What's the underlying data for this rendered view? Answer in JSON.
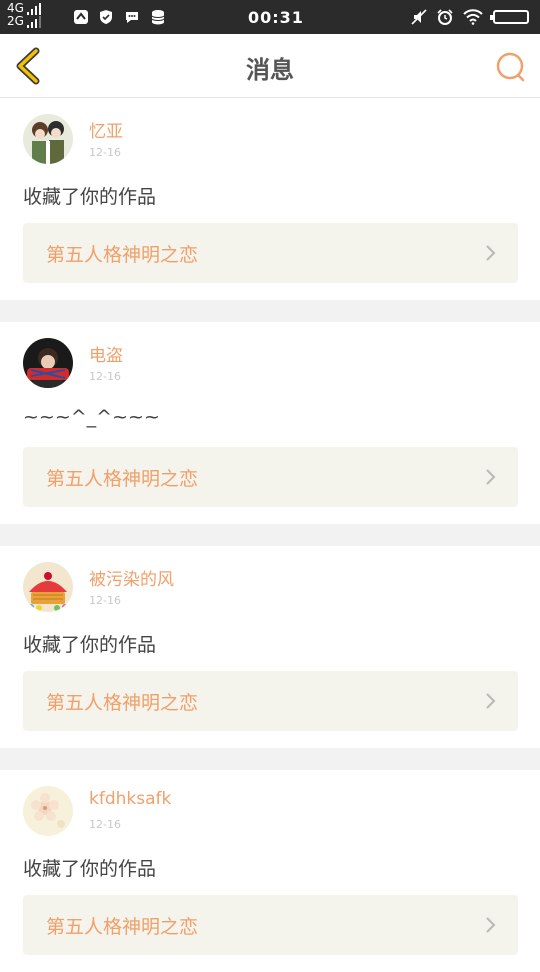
{
  "statusbar": {
    "net_top": "4G",
    "net_bottom": "2G",
    "time": "00:31"
  },
  "navbar": {
    "title": "消息"
  },
  "theme": {
    "accent": "#f0a06a",
    "back_arrow": "#f2c200",
    "work_bg": "#f4f4ec"
  },
  "messages": [
    {
      "username": "忆亚",
      "date": "12-16",
      "text": "收藏了你的作品",
      "work_title": "第五人格神明之恋"
    },
    {
      "username": "电盗",
      "date": "12-16",
      "text": "~~~^_^~~~",
      "work_title": "第五人格神明之恋"
    },
    {
      "username": "被污染的风",
      "date": "12-16",
      "text": "收藏了你的作品",
      "work_title": "第五人格神明之恋"
    },
    {
      "username": "kfdhksafk",
      "date": "12-16",
      "text": "收藏了你的作品",
      "work_title": "第五人格神明之恋"
    }
  ]
}
